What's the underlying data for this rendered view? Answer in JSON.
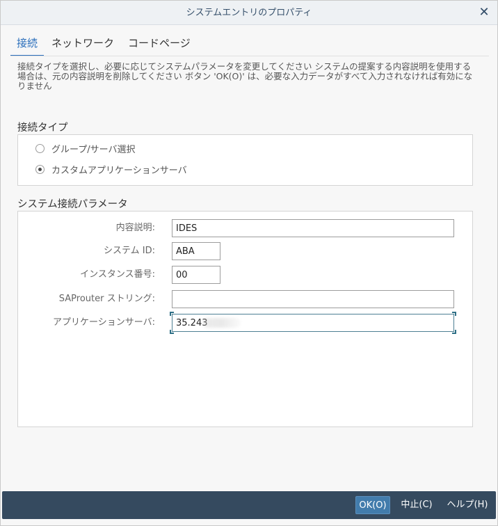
{
  "window": {
    "title": "システムエントリのプロパティ",
    "close_glyph": "✕"
  },
  "tabs": [
    {
      "label": "接続",
      "active": true
    },
    {
      "label": "ネットワーク",
      "active": false
    },
    {
      "label": "コードページ",
      "active": false
    }
  ],
  "description": "接続タイプを選択し、必要に応じてシステムパラメータを変更してください システムの提案する内容説明を使用する場合は、元の内容説明を削除してください ボタン 'OK(O)' は、必要な入力データがすべて入力されなければ有効になりません",
  "connection_type": {
    "title": "接続タイプ",
    "options": [
      {
        "label": "グループ/サーバ選択",
        "checked": false
      },
      {
        "label": "カスタムアプリケーションサーバ",
        "checked": true
      }
    ]
  },
  "system_params": {
    "title": "システム接続パラメータ",
    "fields": {
      "description": {
        "label": "内容説明:",
        "value": "IDES"
      },
      "system_id": {
        "label": "システム ID:",
        "value": "ABA"
      },
      "instance_number": {
        "label": "インスタンス番号:",
        "value": "00"
      },
      "saprouter": {
        "label": "SAProuter ストリング:",
        "value": ""
      },
      "app_server": {
        "label": "アプリケーションサーバ:",
        "value": "35.243"
      }
    }
  },
  "footer": {
    "ok_label": "OK(O)",
    "cancel_label": "中止(C)",
    "help_label": "ヘルプ(H)"
  },
  "colors": {
    "accent": "#2a6ebb",
    "footer_bg": "#354a5f",
    "primary_button": "#427cac"
  }
}
